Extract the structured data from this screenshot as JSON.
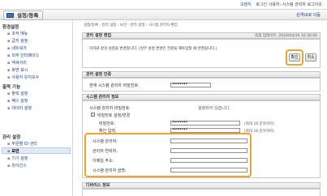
{
  "topbar": {
    "user_label": "오렌지",
    "links_text": "로그인 사용자: 시스템 관리자 로그아웃"
  },
  "header": {
    "title": "설정/등록",
    "portal_link": "원격UI로 이동"
  },
  "sidebar": {
    "sections": [
      {
        "label": "환경설정",
        "items": [
          "조작 메뉴",
          "급지 설정",
          "네트워크",
          "외부 인터페이스",
          "액세서리",
          "화면 표시",
          "사용자 유지보수"
        ]
      },
      {
        "label": "출력 기능",
        "items": [
          "출력 설정",
          "팩스 설정",
          "데이터 설정"
        ]
      },
      {
        "label": "관리 설정",
        "items": [
          "부문별 ID 관리",
          "보안",
          "기기 설정",
          "라이선스"
        ]
      }
    ],
    "active_item": "보안"
  },
  "content": {
    "breadcrumb": "설정/등록 : 관리 설정 : 보안 : 관리 설정 : 시스템 관리자 편집",
    "last_updated": "최종 업데이트: 2024/04/19 10:30:00",
    "edit_section": {
      "header": "관리 설정 편집",
      "message": "이하와 같이 설정을 변경합니다. (일부 설정 변경은 전원을 재투입할 때 반영됩니다.)",
      "ok_button": "확인",
      "cancel_button": "취소"
    },
    "auth_section": {
      "header": "관리 설정 인증",
      "current_pin_label": "현재 시스템 관리자 비밀번호:",
      "current_pin_value": "••••••••"
    },
    "admin_section": {
      "header": "시스템 관리자 정보",
      "pin_status_label": "시스템 관리자 비밀번호:",
      "pin_status_value": "설정되어 있습니다.",
      "change_checkbox_label": "비밀번호 설정/변경",
      "change_checked": true,
      "new_pin_label": "비밀번호:",
      "new_pin_value": "••••••••",
      "new_pin_note": "(최대 16 문자까지)",
      "confirm_pin_label": "확인 입력:",
      "confirm_pin_value": "••••••••",
      "confirm_pin_note": "(최대 16 문자까지)",
      "name_label": "시스템 관리자:",
      "name_value": "",
      "contact_label": "관리자 연락처:",
      "contact_value": "",
      "email_label": "이메일 주소:",
      "email_value": "",
      "comment_label": "시스템 관리자 설명:",
      "comment_value": ""
    },
    "bottom_section": {
      "header": "디바이스 정보"
    }
  }
}
